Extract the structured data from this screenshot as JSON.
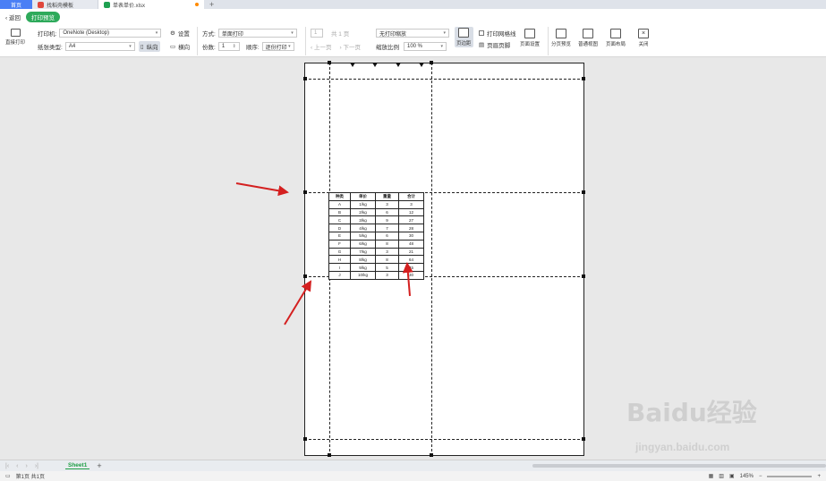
{
  "tabs": {
    "home": "首页",
    "tab1": "找稻壳模板",
    "tab2": "单表单价.xlsx"
  },
  "header": {
    "back": "返回",
    "mode": "打印预览"
  },
  "toolbar": {
    "direct_print": "直接打印",
    "printer_label": "打印机:",
    "printer_value": "OneNote (Desktop)",
    "settings": "设置",
    "paper_type_label": "纸张类型:",
    "paper_value": "A4",
    "portrait": "纵向",
    "landscape": "横向",
    "mode_label": "方式:",
    "mode_value": "单面打印",
    "copies_label": "份数:",
    "copies_value": "1",
    "order_label": "顺序:",
    "order_value": "逐份打印",
    "page_value": "1",
    "page_total": "共 1 页",
    "prev_page": "上一页",
    "next_page": "下一页",
    "scale_value": "无打印缩放",
    "zoom_label": "缩放比例",
    "zoom_value": "100 %",
    "margins": "页边距",
    "print_gridlines": "打印网格线",
    "header_footer": "页眉页脚",
    "page_setup": "页面设置",
    "page_break_preview": "分页预览",
    "normal_view": "普通视图",
    "page_layout": "页面布局",
    "close": "关闭"
  },
  "sheet_table": {
    "headers": [
      "种类",
      "单价",
      "重量",
      "合计"
    ],
    "rows": [
      [
        "A",
        "1/kg",
        "3",
        "3"
      ],
      [
        "B",
        "2/kg",
        "6",
        "12"
      ],
      [
        "C",
        "3/kg",
        "9",
        "27"
      ],
      [
        "D",
        "4/kg",
        "7",
        "28"
      ],
      [
        "E",
        "5/kg",
        "6",
        "30"
      ],
      [
        "F",
        "6/kg",
        "8",
        "48"
      ],
      [
        "G",
        "7/kg",
        "3",
        "21"
      ],
      [
        "H",
        "8/kg",
        "8",
        "64"
      ],
      [
        "I",
        "9/kg",
        "5",
        "45"
      ],
      [
        "J",
        "10/kg",
        "3",
        "30"
      ]
    ]
  },
  "sheetbar": {
    "sheet_name": "Sheet1",
    "add": "+"
  },
  "status": {
    "page_info": "第1页 共1页",
    "zoom": "145%"
  },
  "watermark": {
    "main": "Baidu经验",
    "sub": "jingyan.baidu.com"
  },
  "colors": {
    "accent": "#2eaa5b",
    "home_tab": "#4a7ff5",
    "arrow": "#d42020"
  }
}
